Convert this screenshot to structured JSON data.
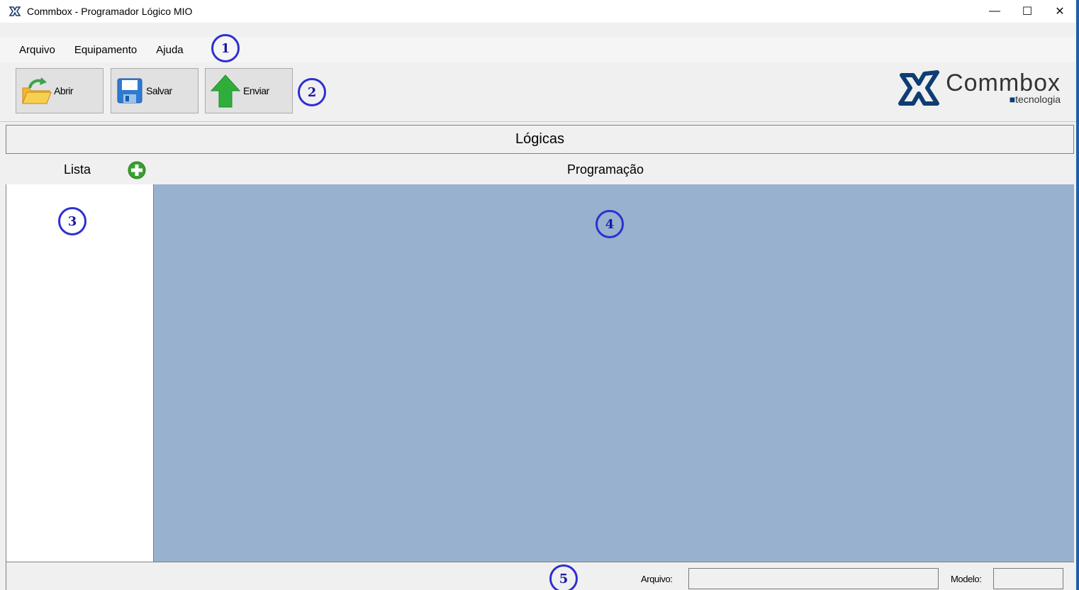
{
  "window": {
    "title": "Commbox - Programador Lógico MIO",
    "controls": {
      "minimize": "—",
      "maximize": "☐",
      "close": "✕"
    }
  },
  "menu": {
    "items": [
      "Arquivo",
      "Equipamento",
      "Ajuda"
    ]
  },
  "toolbar": {
    "open_label": "Abrir",
    "save_label": "Salvar",
    "send_label": "Enviar"
  },
  "logo": {
    "word": "Commbox",
    "sub": "tecnologia"
  },
  "section": {
    "title": "Lógicas"
  },
  "panels": {
    "list_label": "Lista",
    "programming_label": "Programação"
  },
  "status": {
    "file_label": "Arquivo:",
    "file_value": "",
    "model_label": "Modelo:",
    "model_value": ""
  },
  "callouts": [
    "1",
    "2",
    "3",
    "4",
    "5"
  ],
  "colors": {
    "programming_bg": "#98b1cf",
    "callout": "#2f2fcf",
    "window_border": "#1f5fa6"
  }
}
